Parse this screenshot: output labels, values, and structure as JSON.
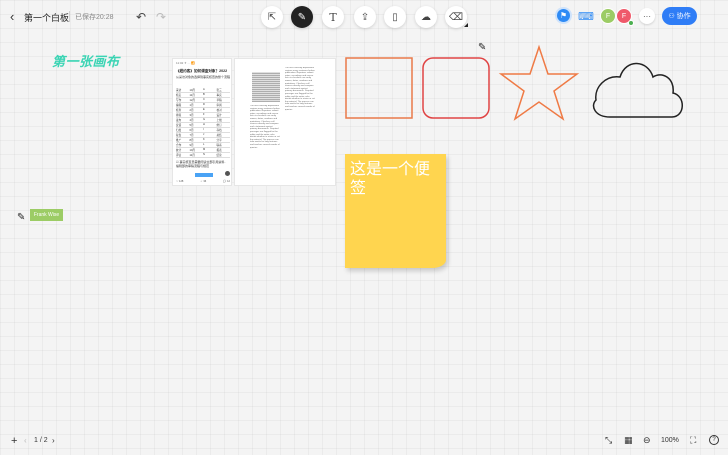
{
  "header": {
    "back_icon": "‹",
    "board_title": "第一个白板",
    "save_status": "已保存20:28",
    "undo_icon": "↶",
    "redo_icon": "↷"
  },
  "toolbar": {
    "select_icon": "⇱",
    "pen_icon": "✎",
    "text_icon": "T",
    "upload_icon": "⇪",
    "file_icon": "▯",
    "shape_icon": "☁",
    "eraser_icon": "⌫"
  },
  "right_header": {
    "present_icon": "⚑",
    "screen_icon": "⌨",
    "avatars": [
      "F",
      "F"
    ],
    "more_icon": "···",
    "collab_icon": "⚇",
    "collab_label": "协作"
  },
  "canvas": {
    "title": "第一张画布",
    "name_tag": "Frank Wise",
    "marker_icon": "✎",
    "sticky_note": "这是一个便签"
  },
  "doc1": {
    "top": "11:02 ✈ ··· 📶",
    "title": "《纽约客》如何调查对象？2022",
    "subtitle": "从采访对象的选择到事实核查的整个流程",
    "rows": [
      [
        "采访",
        "10月",
        "A",
        "张三"
      ],
      [
        "核实",
        "11月",
        "B",
        "事实"
      ],
      [
        "写作",
        "12月",
        "C",
        "草稿"
      ],
      [
        "编辑",
        "1月",
        "D",
        "审阅"
      ],
      [
        "核查",
        "2月",
        "E",
        "校对"
      ],
      [
        "排版",
        "3月",
        "F",
        "设计"
      ],
      [
        "发布",
        "4月",
        "G",
        "上线"
      ],
      [
        "反馈",
        "5月",
        "H",
        "修订"
      ],
      [
        "归档",
        "6月",
        "I",
        "存档"
      ],
      [
        "复盘",
        "7月",
        "J",
        "总结"
      ],
      [
        "推广",
        "8月",
        "K",
        "分享"
      ],
      [
        "合作",
        "9月",
        "L",
        "联系"
      ],
      [
        "统计",
        "10月",
        "M",
        "报表"
      ],
      [
        "评估",
        "11月",
        "N",
        "结论"
      ]
    ],
    "foot": "☑ 事实核查员需要阅读全部引用资料 · 编辑部的审稿流程与规范",
    "bottom": [
      "♡ 128",
      "☆ 36",
      "💬 12"
    ]
  },
  "doc2": {
    "col_text": "The fact-checking department reviews every sentence before publication. Reporters submit notes, recordings and source lists so checkers can verify names, dates, numbers and quotations. Checkers call sources directly and compare each statement against primary documents. Disputed passages are flagged for the editor and the writer, who decide whether to revise or cut the material. The process can take weeks for long features and involves several rounds of queries."
  },
  "footer": {
    "add_icon": "+",
    "prev_icon": "‹",
    "page_indicator": "1 / 2",
    "next_icon": "›",
    "fit_icon": "⤡",
    "map_icon": "▦",
    "zoom_icon": "⊖",
    "zoom_level": "100%",
    "fullscreen_icon": "⛶",
    "help_icon": "?"
  },
  "colors": {
    "accent": "#2f7df6",
    "title_green": "#3bd4b4",
    "sticky": "#ffd54f",
    "rect_stroke": "#e97a4a",
    "rounded_rect_stroke": "#e04444",
    "star_stroke": "#ef7a45",
    "cloud_stroke": "#222222"
  }
}
